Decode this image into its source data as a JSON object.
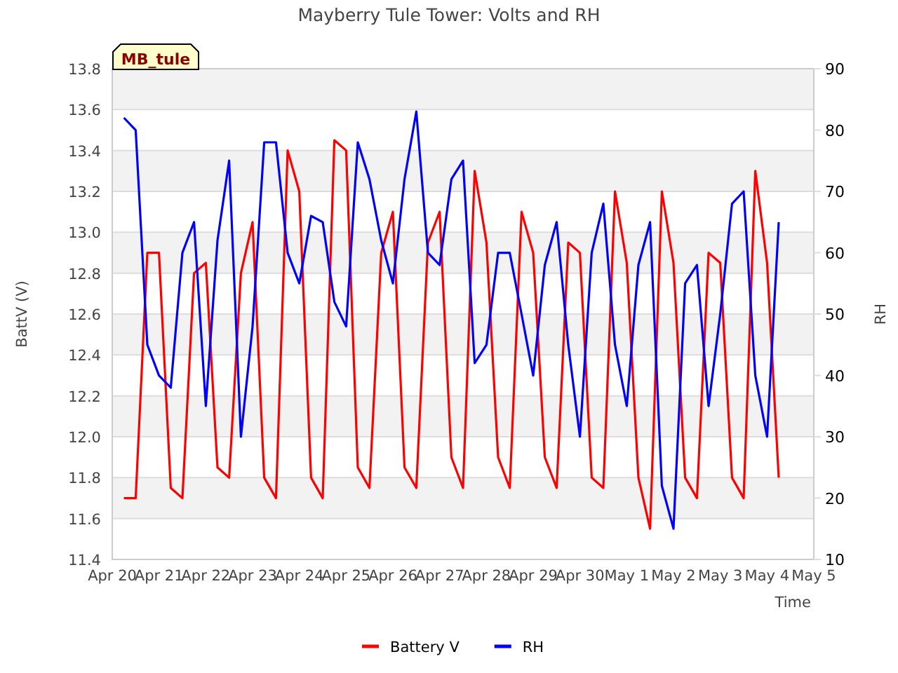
{
  "tag": "MB_tule",
  "chart": {
    "chart_data": {
      "type": "line",
      "title": "Mayberry Tule Tower: Volts and RH",
      "xlabel": "Time",
      "ylabel": "BattV (V)",
      "y2label": "RH",
      "categories": [
        "Apr 20",
        null,
        null,
        null,
        "Apr 21",
        null,
        null,
        null,
        "Apr 22",
        null,
        null,
        null,
        "Apr 23",
        null,
        null,
        null,
        "Apr 24",
        null,
        null,
        null,
        "Apr 25",
        null,
        null,
        null,
        "Apr 26",
        null,
        null,
        null,
        "Apr 27",
        null,
        null,
        null,
        "Apr 28",
        null,
        null,
        null,
        "Apr 29",
        null,
        null,
        null,
        "Apr 30",
        null,
        null,
        null,
        "May 1",
        null,
        null,
        null,
        "May 2",
        null,
        null,
        null,
        "May 3",
        null,
        null,
        null,
        "May 4",
        null,
        null,
        null,
        "May 5"
      ],
      "grid": true,
      "legend": "bottom",
      "ylim": [
        11.4,
        13.8
      ],
      "y2lim": [
        10,
        90
      ],
      "yticks": [
        {
          "value": 11.4,
          "label": "11.4"
        },
        {
          "value": 11.6,
          "label": "11.6"
        },
        {
          "value": 11.8,
          "label": "11.8"
        },
        {
          "value": 12.0,
          "label": "12.0"
        },
        {
          "value": 12.2,
          "label": "12.2"
        },
        {
          "value": 12.4,
          "label": "12.4"
        },
        {
          "value": 12.6,
          "label": "12.6"
        },
        {
          "value": 12.8,
          "label": "12.8"
        },
        {
          "value": 13.0,
          "label": "13.0"
        },
        {
          "value": 13.2,
          "label": "13.2"
        },
        {
          "value": 13.4,
          "label": "13.4"
        },
        {
          "value": 13.6,
          "label": "13.6"
        },
        {
          "value": 13.8,
          "label": "13.8"
        }
      ],
      "y2ticks": [
        10,
        20,
        30,
        40,
        50,
        60,
        70,
        80,
        90
      ],
      "series": [
        {
          "name": "Battery V",
          "color": "#ff0000",
          "values": [
            null,
            11.7,
            11.7,
            12.9,
            12.9,
            11.75,
            11.7,
            12.8,
            12.85,
            11.85,
            11.8,
            12.8,
            13.05,
            11.8,
            11.7,
            13.4,
            13.2,
            11.8,
            11.7,
            13.45,
            13.4,
            11.85,
            11.75,
            12.9,
            13.1,
            11.85,
            11.75,
            12.95,
            13.1,
            11.9,
            11.75,
            13.3,
            12.95,
            11.9,
            11.75,
            13.1,
            12.9,
            11.9,
            11.75,
            12.95,
            12.9,
            11.8,
            11.75,
            13.2,
            12.85,
            11.8,
            11.55,
            13.2,
            12.85,
            11.8,
            11.7,
            12.9,
            12.85,
            11.8,
            11.7,
            13.3,
            12.85,
            11.8,
            null,
            null,
            null
          ]
        },
        {
          "name": "RH",
          "color": "#0000ff",
          "axis": "y2",
          "values": [
            null,
            82,
            80,
            45,
            40,
            38,
            60,
            65,
            35,
            62,
            75,
            30,
            48,
            78,
            78,
            60,
            55,
            66,
            65,
            52,
            48,
            78,
            72,
            62,
            55,
            72,
            83,
            60,
            58,
            72,
            75,
            42,
            45,
            60,
            60,
            50,
            40,
            58,
            65,
            45,
            30,
            60,
            68,
            45,
            35,
            58,
            65,
            22,
            15,
            55,
            58,
            35,
            50,
            68,
            70,
            40,
            30,
            65,
            null,
            null,
            null
          ]
        }
      ]
    }
  }
}
